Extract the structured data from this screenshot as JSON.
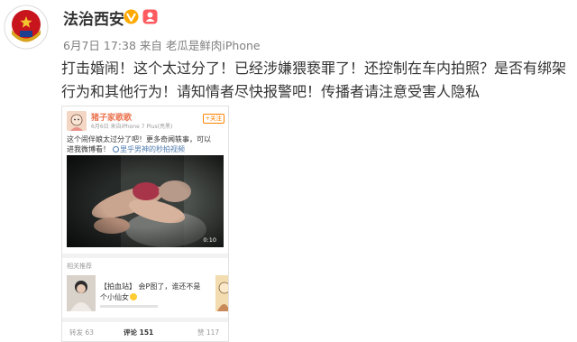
{
  "post": {
    "author": "法治西安",
    "date": "6月7日 17:38",
    "from_label": "来自",
    "source": "老瓜是鲜肉iPhone",
    "text_lines": [
      "打击婚闹！这个太过分了！已经涉嫌猥亵罪了！还控制在车内拍照？是否有绑架",
      "行为和其他行为！请知情者尽快报警吧！传播者请注意受害人隐私"
    ]
  },
  "icons": {
    "avatar": "police-emblem-avatar",
    "verified": "verified-v-icon",
    "member": "weibo-member-icon",
    "video_link": "video-link-icon",
    "emoji": "laugh-emoji-icon"
  },
  "embedded": {
    "author": "猪子家歌歌",
    "follow": "+关注",
    "meta": "6月6日  来自iPhone 7 Plus(亮黑)",
    "text_lines": [
      "这个闹伴娘太过分了吧！更多奇闻轶事，可以",
      "进我微博看！"
    ],
    "video_link": "里乎男神的秒拍视频",
    "video_duration": "0:10",
    "related_title": "相关推荐",
    "related_lines": [
      "【拍血站】 会P图了，谁还不是",
      "个小仙女"
    ],
    "actions": {
      "repost": "转发 63",
      "comment": "评论 151",
      "like": "赞 117"
    }
  },
  "colors": {
    "text": "#333333",
    "meta": "#808080",
    "verified": "#ffa800",
    "member": "#ff5a5f",
    "embedded_author": "#eb7350",
    "follow": "#ff8200",
    "link": "#507daf"
  }
}
